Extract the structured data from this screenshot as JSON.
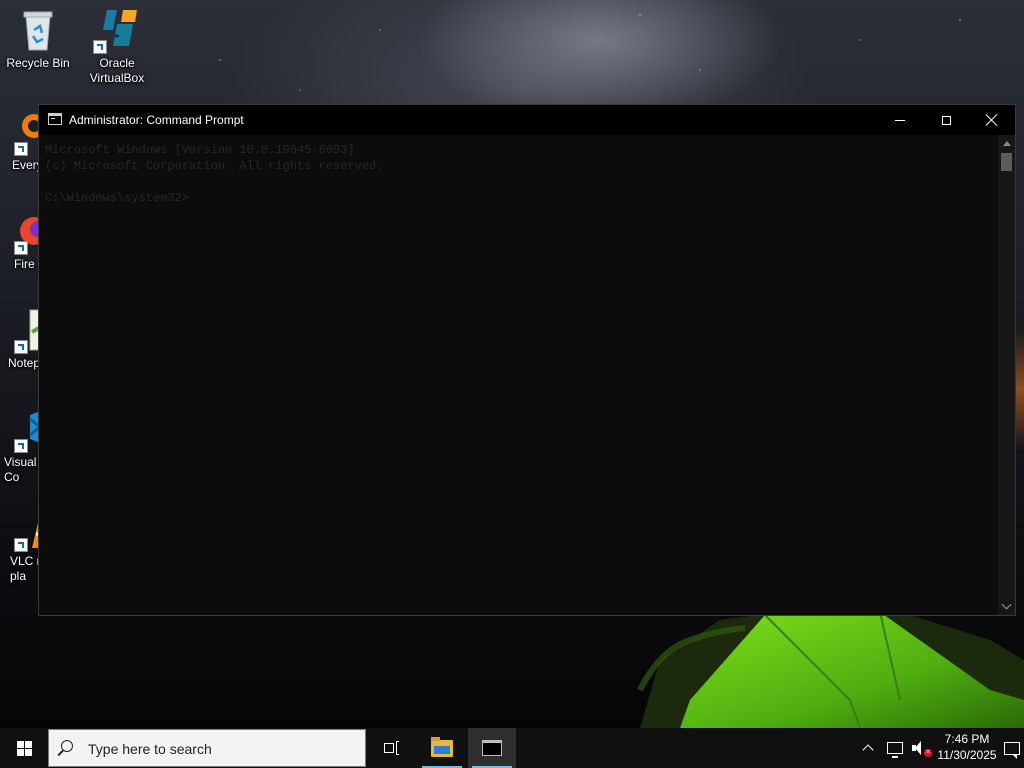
{
  "desktop": {
    "icons": [
      {
        "label": "Recycle Bin"
      },
      {
        "label": "Oracle VirtualBox"
      },
      {
        "label": "Every"
      },
      {
        "label": "Fire"
      },
      {
        "label": "Notep"
      },
      {
        "label": "Visual Co"
      },
      {
        "label": "VLC r pla"
      }
    ]
  },
  "window": {
    "title": "Administrator: Command Prompt",
    "content_lines": [
      "Microsoft Windows [Version 10.0.19045.6093]",
      "(c) Microsoft Corporation. All rights reserved.",
      "",
      "C:\\Windows\\system32>"
    ]
  },
  "taskbar": {
    "search_placeholder": "Type here to search",
    "time": "7:46 PM",
    "date": "11/30/2025"
  },
  "colors": {
    "accent": "#76b9ed",
    "taskbar": "#101010",
    "console_bg": "#0c0c0c",
    "mute_badge": "#e81123"
  },
  "icons": [
    "recycle-bin-icon",
    "virtualbox-icon",
    "everything-icon",
    "firefox-icon",
    "notepad-icon",
    "vscode-icon",
    "vlc-icon",
    "cmd-icon",
    "windows-logo-icon",
    "search-icon",
    "task-view-icon",
    "file-explorer-icon",
    "chevron-up-icon",
    "network-icon",
    "volume-muted-icon",
    "notification-icon"
  ]
}
